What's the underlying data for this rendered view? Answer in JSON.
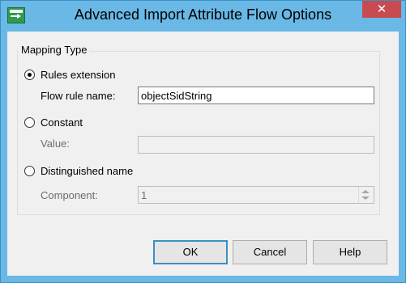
{
  "window": {
    "title": "Advanced Import Attribute Flow Options",
    "close_glyph": "✕",
    "app_icon": "dialog-app-icon"
  },
  "mapping_type": {
    "legend": "Mapping Type",
    "options": [
      {
        "label": "Rules extension",
        "selected": true
      },
      {
        "label": "Constant",
        "selected": false
      },
      {
        "label": "Distinguished name",
        "selected": false
      }
    ],
    "flow_rule_name": {
      "label": "Flow rule name:",
      "value": "objectSidString"
    },
    "value_field": {
      "label": "Value:",
      "value": ""
    },
    "component": {
      "label": "Component:",
      "value": "1"
    }
  },
  "buttons": {
    "ok": "OK",
    "cancel": "Cancel",
    "help": "Help"
  },
  "colors": {
    "titlebar": "#6ab8e6",
    "close_button": "#c74b50",
    "client_bg": "#f0f0f0"
  }
}
